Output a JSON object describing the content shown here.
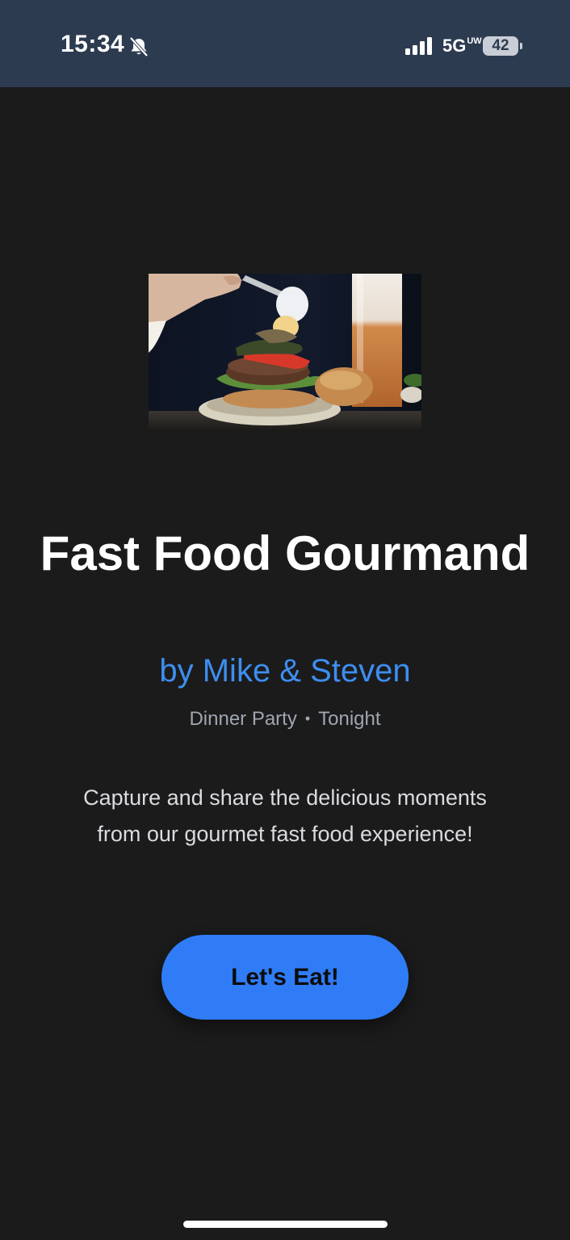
{
  "status_bar": {
    "time": "15:34",
    "network": "5G",
    "network_sub": "UW",
    "battery": "42"
  },
  "hero": {
    "title": "Fast Food Gourmand",
    "byline": "by Mike & Steven",
    "event_type": "Dinner Party",
    "separator": "•",
    "event_time": "Tonight",
    "description": "Capture and share the delicious moments from our gourmet fast food experience!",
    "cta_label": "Let's Eat!"
  },
  "colors": {
    "background": "#1b1b1c",
    "status_bar": "#2c3b50",
    "accent": "#3d8ef0",
    "button": "#2f7cf6"
  },
  "icons": [
    "bell-off-icon",
    "cellular-signal-icon",
    "battery-icon"
  ]
}
